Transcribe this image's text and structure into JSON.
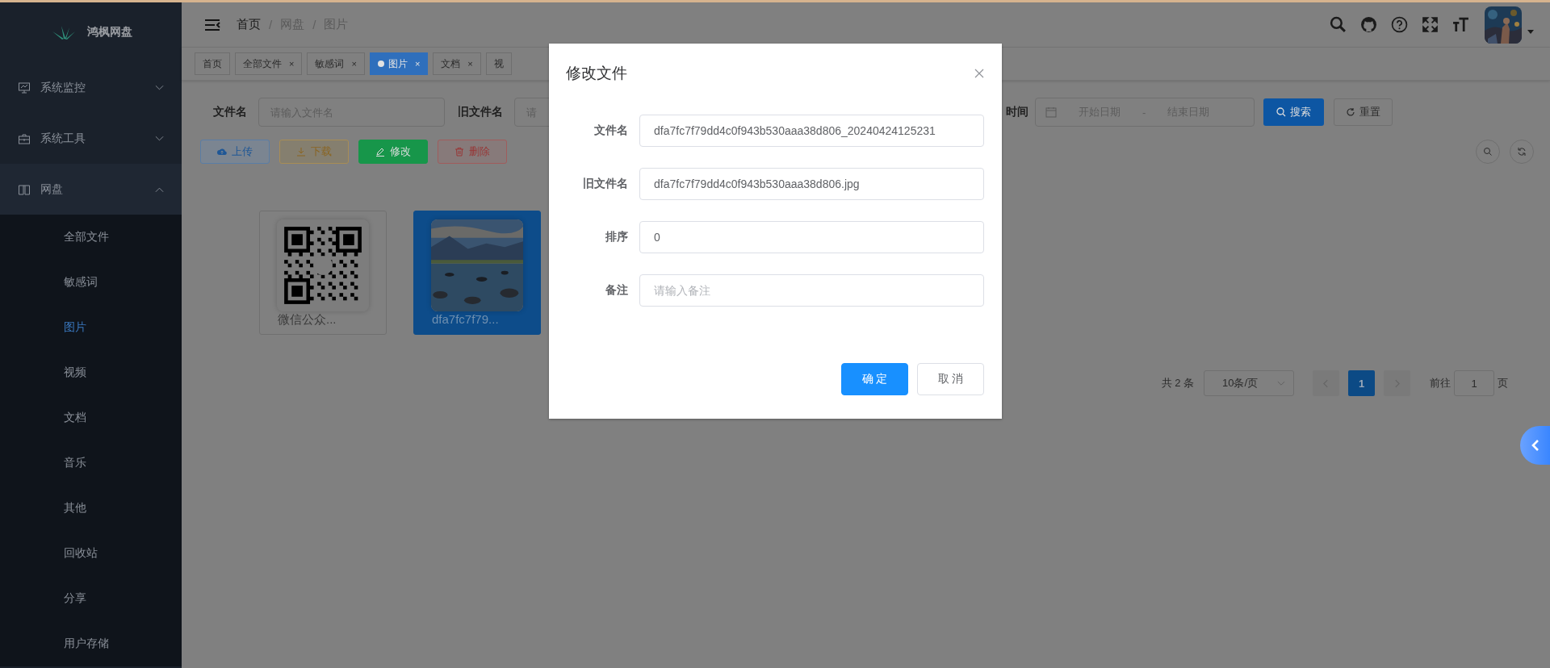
{
  "sidebar": {
    "logo": "鸿枫网盘",
    "menus": [
      {
        "label": "系统监控",
        "expanded": false
      },
      {
        "label": "系统工具",
        "expanded": false
      },
      {
        "label": "网盘",
        "expanded": true,
        "children": [
          {
            "label": "全部文件",
            "selected": false
          },
          {
            "label": "敏感词",
            "selected": false
          },
          {
            "label": "图片",
            "selected": true
          },
          {
            "label": "视频",
            "selected": false
          },
          {
            "label": "文档",
            "selected": false
          },
          {
            "label": "音乐",
            "selected": false
          },
          {
            "label": "其他",
            "selected": false
          },
          {
            "label": "回收站",
            "selected": false
          },
          {
            "label": "分享",
            "selected": false
          },
          {
            "label": "用户存储",
            "selected": false
          }
        ]
      }
    ]
  },
  "breadcrumb": {
    "items": [
      "首页",
      "网盘",
      "图片"
    ],
    "separator": "/"
  },
  "tags": [
    {
      "label": "首页",
      "selected": false
    },
    {
      "label": "全部文件",
      "selected": false,
      "close": "×"
    },
    {
      "label": "敏感词",
      "selected": false,
      "close": "×"
    },
    {
      "label": "图片",
      "selected": true,
      "close": "×"
    },
    {
      "label": "文档",
      "selected": false,
      "close": "×"
    },
    {
      "label": "视",
      "selected": false
    }
  ],
  "search": {
    "fields": [
      {
        "label": "文件名",
        "placeholder": "请输入文件名"
      },
      {
        "label": "旧文件名",
        "placeholder": "请"
      }
    ],
    "date": {
      "label": "时间",
      "start_placeholder": "开始日期",
      "separator": "-",
      "end_placeholder": "结束日期"
    },
    "search_button": "搜索",
    "reset_button": "重置"
  },
  "toolbar": [
    {
      "label": "上传",
      "kind": "upload"
    },
    {
      "label": "下载",
      "kind": "download"
    },
    {
      "label": "修改",
      "kind": "edit"
    },
    {
      "label": "删除",
      "kind": "delete"
    }
  ],
  "files": [
    {
      "name": "微信公众...",
      "kind": "qr",
      "selected": false
    },
    {
      "name": "dfa7fc7f79...",
      "selected": true
    }
  ],
  "pagination": {
    "total": "共 2 条",
    "page_size": "10条/页",
    "pages": [
      {
        "label": "1",
        "selected": true
      }
    ],
    "goto_label": "前往",
    "goto_value": "1",
    "page_unit": "页"
  },
  "dialog": {
    "title": "修改文件",
    "fields": [
      {
        "label": "文件名",
        "value": "dfa7fc7f79dd4c0f943b530aaa38d806_20240424125231"
      },
      {
        "label": "旧文件名",
        "value": "dfa7fc7f79dd4c0f943b530aaa38d806.jpg"
      },
      {
        "label": "排序",
        "value": "0"
      },
      {
        "label": "备注",
        "placeholder": "请输入备注"
      }
    ],
    "buttons": [
      {
        "label": "确 定",
        "kind": "primary"
      },
      {
        "label": "取 消",
        "kind": "default"
      }
    ]
  }
}
